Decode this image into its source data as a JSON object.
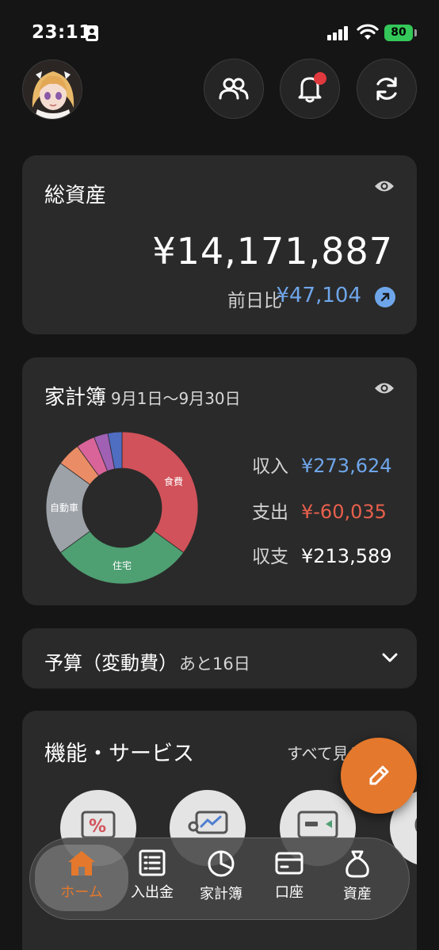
{
  "status_bar": {
    "time": "23:11",
    "battery": "80"
  },
  "colors": {
    "accent": "#e4782c",
    "positive": "#6fa6ea",
    "negative": "#e8604c",
    "card": "#2a2a2a",
    "background": "#151515"
  },
  "total_assets": {
    "title": "総資産",
    "value": "¥14,171,887",
    "prev_day_label": "前日比",
    "prev_day_value": "¥47,104"
  },
  "household": {
    "title": "家計簿",
    "date_range": "9月1日～9月30日",
    "income_label": "収入",
    "income_value": "¥273,624",
    "expense_label": "支出",
    "expense_value": "¥-60,035",
    "balance_label": "収支",
    "balance_value": "¥213,589"
  },
  "chart_data": {
    "type": "pie",
    "style": "donut",
    "slices": [
      {
        "name": "食費",
        "value": 35,
        "color": "#d1525a"
      },
      {
        "name": "住宅",
        "value": 30,
        "color": "#4e9f72"
      },
      {
        "name": "自動車",
        "value": 20,
        "color": "#9da2a8"
      },
      {
        "name": "",
        "value": 5,
        "color": "#ea8c65"
      },
      {
        "name": "",
        "value": 4,
        "color": "#d9649a"
      },
      {
        "name": "",
        "value": 3,
        "color": "#a060b4"
      },
      {
        "name": "",
        "value": 3,
        "color": "#4f6dc1"
      }
    ]
  },
  "budget": {
    "title": "予算（変動費）",
    "remaining": "あと16日"
  },
  "services": {
    "title": "機能・サービス",
    "see_all": "すべて見る"
  },
  "nav": [
    {
      "label": "ホーム",
      "icon": "home-icon"
    },
    {
      "label": "入出金",
      "icon": "list-icon"
    },
    {
      "label": "家計簿",
      "icon": "pie-chart-icon"
    },
    {
      "label": "口座",
      "icon": "wallet-icon"
    },
    {
      "label": "資産",
      "icon": "money-bag-icon"
    }
  ]
}
